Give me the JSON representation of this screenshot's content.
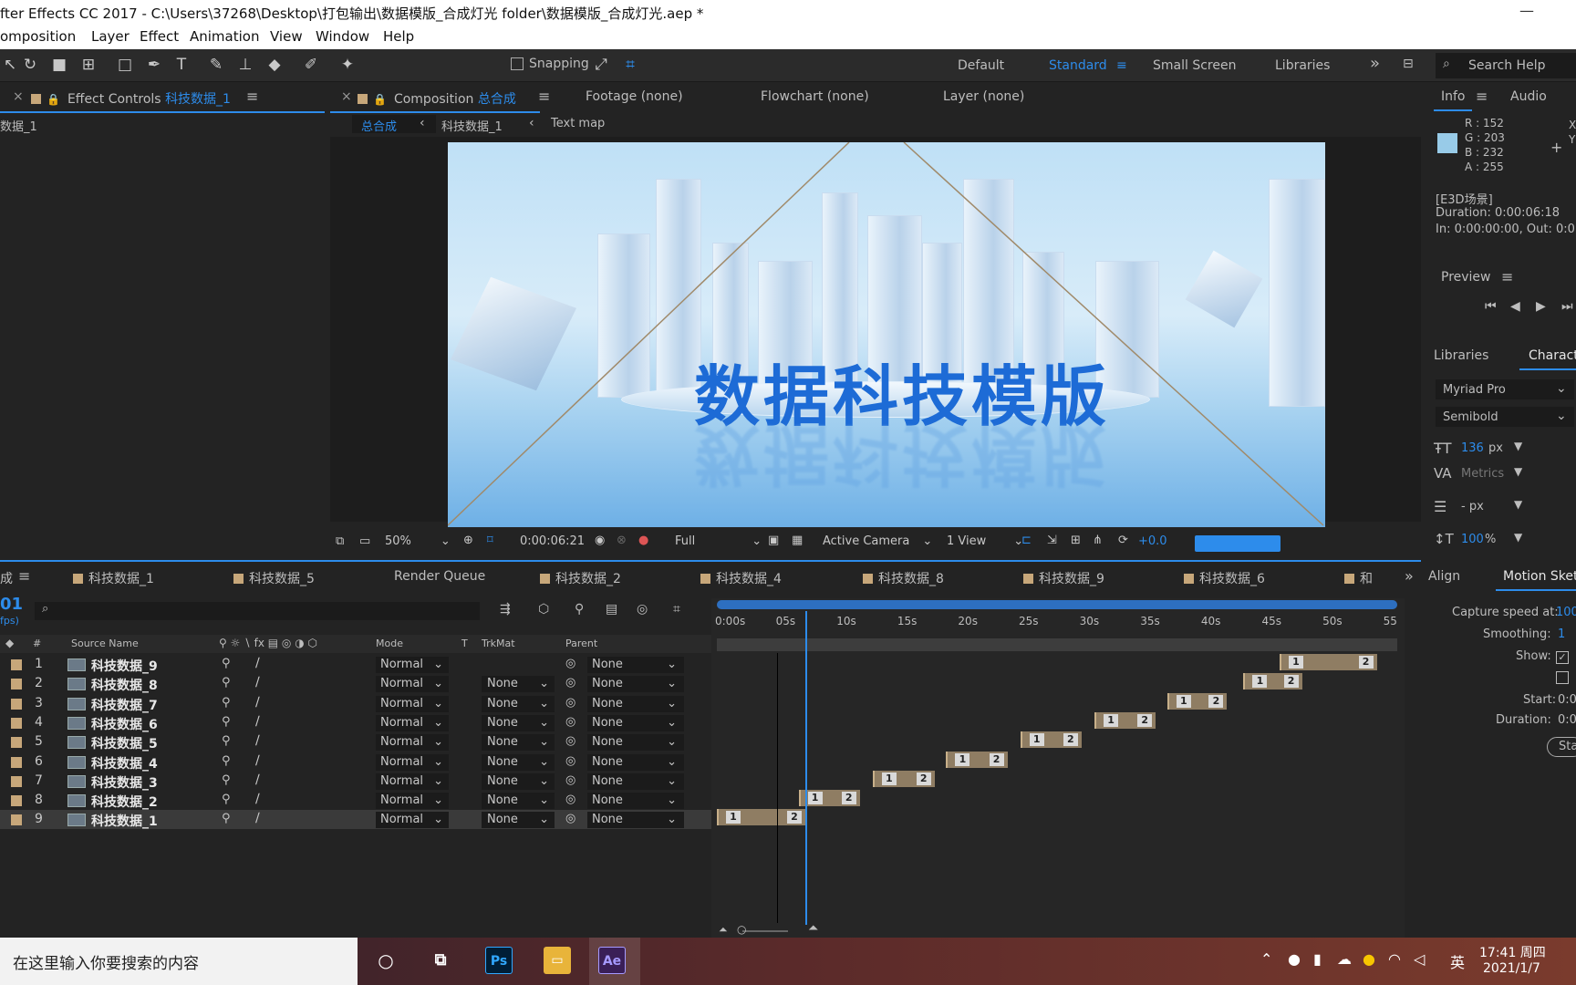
{
  "window": {
    "title": "fter Effects CC 2017 - C:\\Users\\37268\\Desktop\\打包输出\\数据模版_合成灯光 folder\\数据模版_合成灯光.aep *",
    "minimize": "—"
  },
  "menu": [
    "omposition",
    "Layer",
    "Effect",
    "Animation",
    "View",
    "Window",
    "Help"
  ],
  "toolbar": {
    "snapping": "Snapping",
    "workspaces": [
      "Default",
      "Standard",
      "Small Screen",
      "Libraries"
    ],
    "active_workspace": "Standard",
    "more": "»",
    "search_help": "Search Help"
  },
  "effect_controls": {
    "tab_prefix": "Effect Controls",
    "tab_layer": "科技数据_1",
    "layer_label": "数据_1"
  },
  "composition": {
    "tab_prefix": "Composition",
    "tab_name": "总合成",
    "other_tabs": [
      "Footage (none)",
      "Flowchart (none)",
      "Layer (none)"
    ],
    "breadcrumbs": [
      "总合成",
      "科技数据_1",
      "Text map"
    ],
    "title_text": "数据科技模版"
  },
  "viewer_bar": {
    "zoom": "50%",
    "timecode": "0:00:06:21",
    "resolution": "Full",
    "camera": "Active Camera",
    "view": "1 View",
    "exposure": "+0.0"
  },
  "info": {
    "tabs": [
      "Info",
      "Audio"
    ],
    "r": "R : 152",
    "g": "G : 203",
    "b": "B : 232",
    "a": "A : 255",
    "x": "X",
    "y": "Y",
    "swatch": "#98cbe8",
    "layer": "[E3D场景]",
    "duration": "Duration: 0:00:06:18",
    "inout": "In: 0:00:00:00, Out: 0:0"
  },
  "preview": {
    "title": "Preview"
  },
  "character": {
    "tabs": [
      "Libraries",
      "Characte"
    ],
    "font": "Myriad Pro",
    "style": "Semibold",
    "size": "136",
    "size_unit": "px",
    "metrics": "Metrics",
    "leading": "- px",
    "scale": "100",
    "scale_unit": "%"
  },
  "motion_sketch": {
    "tabs": [
      "Align",
      "Motion Sketc"
    ],
    "capture_label": "Capture speed at:",
    "capture_val": "100",
    "smoothing_label": "Smoothing:",
    "smoothing_val": "1",
    "show_label": "Show:",
    "start_label": "Start:",
    "start_val": "0:0",
    "duration_label": "Duration:",
    "duration_val": "0:0",
    "start_btn": "Sta"
  },
  "timeline": {
    "tabs": [
      "成",
      "科技数据_1",
      "科技数据_5",
      "Render Queue",
      "科技数据_2",
      "科技数据_4",
      "科技数据_8",
      "科技数据_9",
      "科技数据_6",
      "和"
    ],
    "timecode": "01",
    "fps": "fps)",
    "columns": {
      "num": "#",
      "source": "Source Name",
      "mode": "Mode",
      "t": "T",
      "trkmat": "TrkMat",
      "parent": "Parent"
    },
    "ruler": [
      "0:00s",
      "05s",
      "10s",
      "15s",
      "20s",
      "25s",
      "30s",
      "35s",
      "40s",
      "45s",
      "50s",
      "55"
    ],
    "layers": [
      {
        "num": "1",
        "name": "科技数据_9",
        "mode": "Normal",
        "trkmat": "",
        "parent": "None",
        "start": 0.827,
        "end": 0.97
      },
      {
        "num": "2",
        "name": "科技数据_8",
        "mode": "Normal",
        "trkmat": "None",
        "parent": "None",
        "start": 0.774,
        "end": 0.86
      },
      {
        "num": "3",
        "name": "科技数据_7",
        "mode": "Normal",
        "trkmat": "None",
        "parent": "None",
        "start": 0.662,
        "end": 0.75
      },
      {
        "num": "4",
        "name": "科技数据_6",
        "mode": "Normal",
        "trkmat": "None",
        "parent": "None",
        "start": 0.555,
        "end": 0.645
      },
      {
        "num": "5",
        "name": "科技数据_5",
        "mode": "Normal",
        "trkmat": "None",
        "parent": "None",
        "start": 0.446,
        "end": 0.536
      },
      {
        "num": "6",
        "name": "科技数据_4",
        "mode": "Normal",
        "trkmat": "None",
        "parent": "None",
        "start": 0.337,
        "end": 0.427
      },
      {
        "num": "7",
        "name": "科技数据_3",
        "mode": "Normal",
        "trkmat": "None",
        "parent": "None",
        "start": 0.229,
        "end": 0.32
      },
      {
        "num": "8",
        "name": "科技数据_2",
        "mode": "Normal",
        "trkmat": "None",
        "parent": "None",
        "start": 0.12,
        "end": 0.21
      },
      {
        "num": "9",
        "name": "科技数据_1",
        "mode": "Normal",
        "trkmat": "None",
        "parent": "None",
        "start": 0.0,
        "end": 0.13
      }
    ],
    "playhead": 0.13
  },
  "taskbar": {
    "search": "在这里输入你要搜索的内容",
    "apps": [
      "Ps",
      "Ae"
    ],
    "time": "17:41 周四",
    "date": "2021/1/7",
    "ime": "英"
  }
}
